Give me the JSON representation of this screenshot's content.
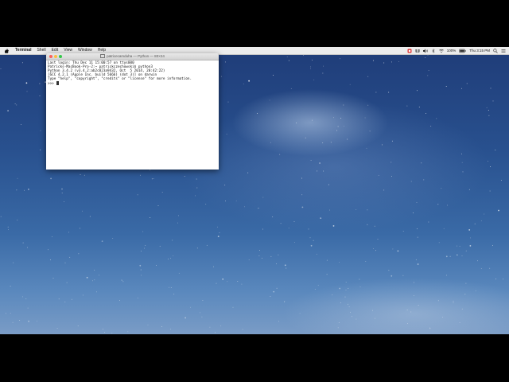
{
  "menubar": {
    "app_name": "Terminal",
    "items": [
      "Shell",
      "Edit",
      "View",
      "Window",
      "Help"
    ],
    "status": {
      "battery": "100%",
      "clock": "Thu 3:15 PM"
    }
  },
  "terminal": {
    "title": "patricecamduha — Python — 80×24",
    "lines": [
      "Last login: Thu Dec 11 15:00:57 on ttys000",
      "Patricks-MacBook-Pro-2:~ patrickczechowski$ python3",
      "Python 3.4.2 (v3.4.2:ab2c023a9432, Oct  5 2014, 20:42:22)",
      "[GCC 4.2.1 (Apple Inc. build 5666) (dot 3)] on darwin",
      "Type \"help\", \"copyright\", \"credits\" or \"license\" for more information."
    ],
    "prompt": ">>> "
  },
  "icons": [
    "apple-icon",
    "recording-icon",
    "dropbox-icon",
    "volume-icon",
    "bluetooth-icon",
    "wifi-icon",
    "battery-icon",
    "search-icon",
    "list-icon"
  ]
}
